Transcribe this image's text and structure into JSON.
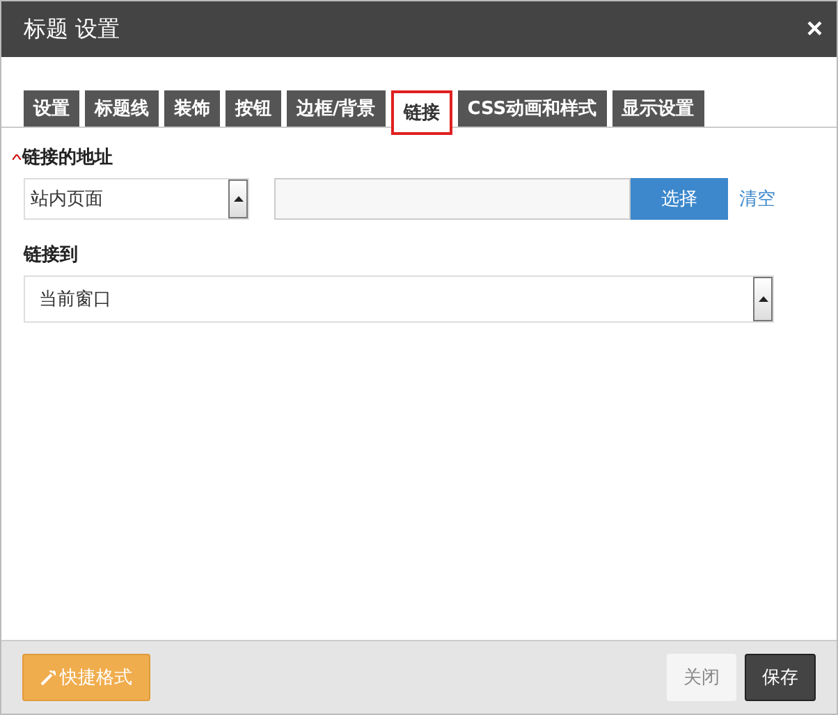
{
  "window": {
    "title": "标题 设置",
    "close": "×"
  },
  "tabs": [
    {
      "label": "设置",
      "selected": false
    },
    {
      "label": "标题线",
      "selected": false
    },
    {
      "label": "装饰",
      "selected": false
    },
    {
      "label": "按钮",
      "selected": false
    },
    {
      "label": "边框/背景",
      "selected": false
    },
    {
      "label": "链接",
      "selected": true
    },
    {
      "label": "CSS动画和样式",
      "selected": false
    },
    {
      "label": "显示设置",
      "selected": false
    }
  ],
  "link_address": {
    "label": "链接的地址",
    "required": true,
    "type_select": "站内页面",
    "select_button": "选择",
    "clear_link": "清空"
  },
  "link_to": {
    "label": "链接到",
    "select": "当前窗口"
  },
  "footer": {
    "quick_format": "快捷格式",
    "close": "关闭",
    "save": "保存"
  }
}
